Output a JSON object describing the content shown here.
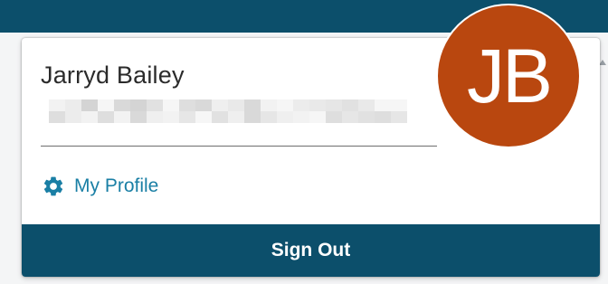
{
  "user_menu": {
    "user_name": "Jarryd Bailey",
    "email_redacted": true,
    "profile_link_label": "My Profile",
    "profile_icon": "gear-icon",
    "sign_out_label": "Sign Out",
    "avatar_initials": "JB"
  },
  "colors": {
    "header_bg": "#0c4f6b",
    "sign_out_bg": "#0c4f6b",
    "link": "#1a7fa5",
    "avatar_bg": "#b9470f"
  }
}
